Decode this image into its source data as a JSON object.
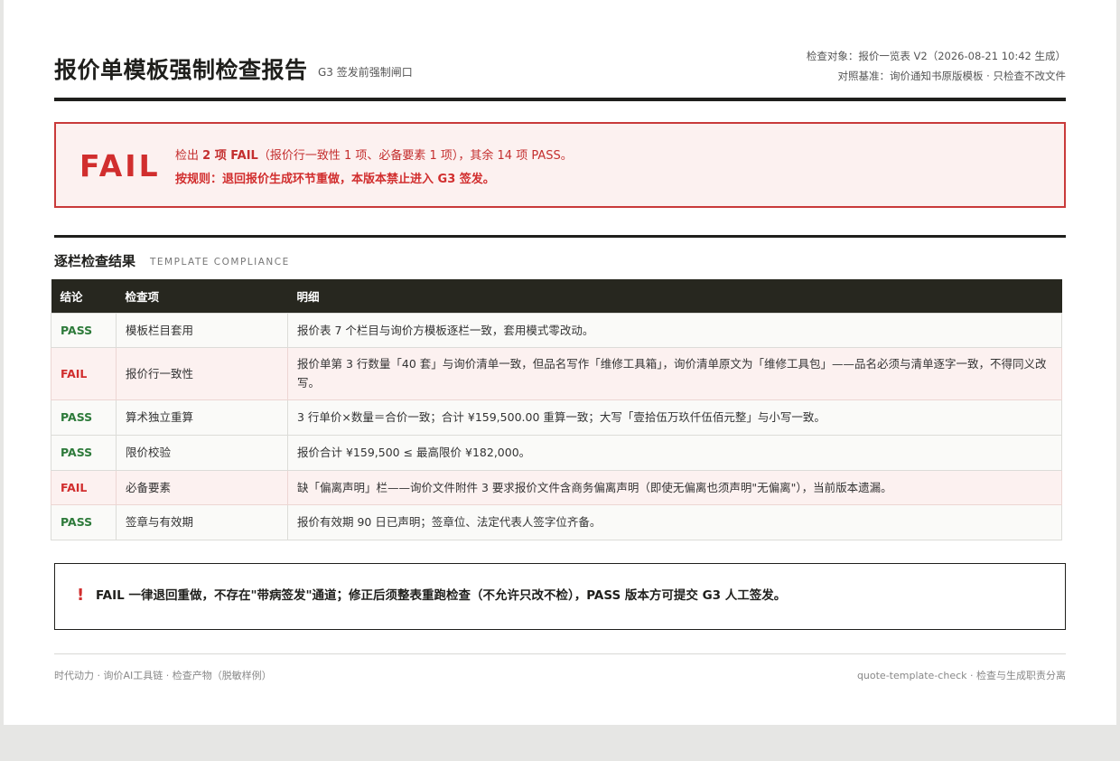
{
  "header": {
    "title": "报价单模板强制检查报告",
    "subtitle": "G3 签发前强制闸口",
    "meta_line1": "检查对象：报价一览表 V2（2026-08-21 10:42 生成）",
    "meta_line2": "对照基准：询价通知书原版模板 · 只检查不改文件"
  },
  "banner": {
    "verdict": "FAIL",
    "line1_prefix": "检出 ",
    "line1_count": "2 项 FAIL",
    "line1_rest": "（报价行一致性 1 项、必备要素 1 项），其余 14 项 PASS。",
    "line2": "按规则：退回报价生成环节重做，本版本禁止进入 G3 签发。"
  },
  "section": {
    "title": "逐栏检查结果",
    "subtitle": "TEMPLATE COMPLIANCE"
  },
  "table": {
    "columns": [
      "结论",
      "检查项",
      "明细"
    ],
    "rows": [
      {
        "status": "PASS",
        "item": "模板栏目套用",
        "detail": "报价表 7 个栏目与询价方模板逐栏一致，套用模式零改动。"
      },
      {
        "status": "FAIL",
        "item": "报价行一致性",
        "detail": "报价单第 3 行数量「40 套」与询价清单一致，但品名写作「维修工具箱」，询价清单原文为「维修工具包」——品名必须与清单逐字一致，不得同义改写。"
      },
      {
        "status": "PASS",
        "item": "算术独立重算",
        "detail": "3 行单价×数量＝合价一致；合计 ¥159,500.00 重算一致；大写「壹拾伍万玖仟伍佰元整」与小写一致。"
      },
      {
        "status": "PASS",
        "item": "限价校验",
        "detail": "报价合计 ¥159,500 ≤ 最高限价 ¥182,000。"
      },
      {
        "status": "FAIL",
        "item": "必备要素",
        "detail": "缺「偏离声明」栏——询价文件附件 3 要求报价文件含商务偏离声明（即使无偏离也须声明\"无偏离\"），当前版本遗漏。"
      },
      {
        "status": "PASS",
        "item": "签章与有效期",
        "detail": "报价有效期 90 日已声明；签章位、法定代表人签字位齐备。"
      }
    ]
  },
  "notice": {
    "mark": "!",
    "text": "FAIL 一律退回重做，不存在\"带病签发\"通道；修正后须整表重跑检查（不允许只改不检），PASS 版本方可提交 G3 人工签发。"
  },
  "footer": {
    "left": "时代动力 · 询价AI工具链 · 检查产物（脱敏样例）",
    "right": "quote-template-check · 检查与生成职责分离"
  },
  "colors": {
    "fail": "#d12e2e",
    "pass": "#2d7a3a",
    "dark": "#1f1f1c"
  }
}
